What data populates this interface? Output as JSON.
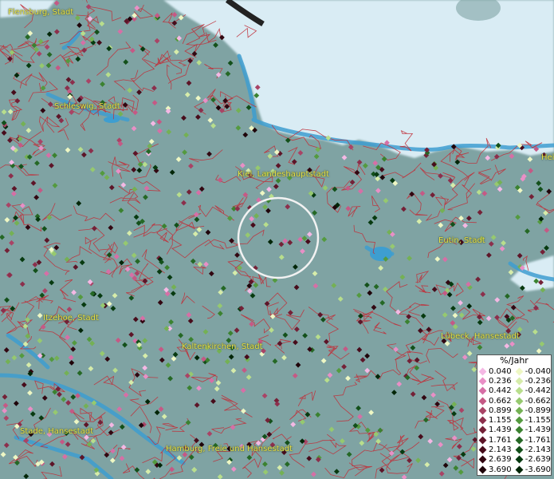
{
  "map": {
    "places": [
      {
        "name": "Flensburg, Stadt"
      },
      {
        "name": "Schleswig, Stadt"
      },
      {
        "name": "Kiel, Landeshauptstadt"
      },
      {
        "name": "Eutin, Stadt"
      },
      {
        "name": "Itzehoe, Stadt"
      },
      {
        "name": "Kaltenkirchen, Stadt"
      },
      {
        "name": "Lübeck, Hansestadt"
      },
      {
        "name": "Stade, Hansestadt"
      },
      {
        "name": "Hamburg, Freie und Hansestadt"
      },
      {
        "name": "Hei"
      }
    ],
    "colors": {
      "water": "#d9ecf4",
      "land": "#7fa3a3",
      "boundary": "#c0303a",
      "label": "#e8e14a"
    }
  },
  "legend": {
    "title": "%/Jahr",
    "positive": [
      {
        "label": "0.040",
        "color": "#f4b8e4"
      },
      {
        "label": "0.236",
        "color": "#e98fc6"
      },
      {
        "label": "0.442",
        "color": "#d66fa6"
      },
      {
        "label": "0.662",
        "color": "#c55985"
      },
      {
        "label": "0.899",
        "color": "#a94466"
      },
      {
        "label": "1.155",
        "color": "#8c2f4c"
      },
      {
        "label": "1.439",
        "color": "#742137"
      },
      {
        "label": "1.761",
        "color": "#5d1528"
      },
      {
        "label": "2.143",
        "color": "#470c1b"
      },
      {
        "label": "2.639",
        "color": "#320711"
      },
      {
        "label": "3.690",
        "color": "#1f040a"
      }
    ],
    "negative": [
      {
        "label": "-0.040",
        "color": "#eef7c4"
      },
      {
        "label": "-0.236",
        "color": "#d6ecaa"
      },
      {
        "label": "-0.442",
        "color": "#b8de8c"
      },
      {
        "label": "-0.662",
        "color": "#96c96f"
      },
      {
        "label": "-0.899",
        "color": "#74b154"
      },
      {
        "label": "-1.155",
        "color": "#549a3f"
      },
      {
        "label": "-1.439",
        "color": "#3b8230"
      },
      {
        "label": "-1.761",
        "color": "#256825"
      },
      {
        "label": "-2.143",
        "color": "#13501a"
      },
      {
        "label": "-2.639",
        "color": "#073a10"
      },
      {
        "label": "-3.690",
        "color": "#022608"
      }
    ]
  }
}
